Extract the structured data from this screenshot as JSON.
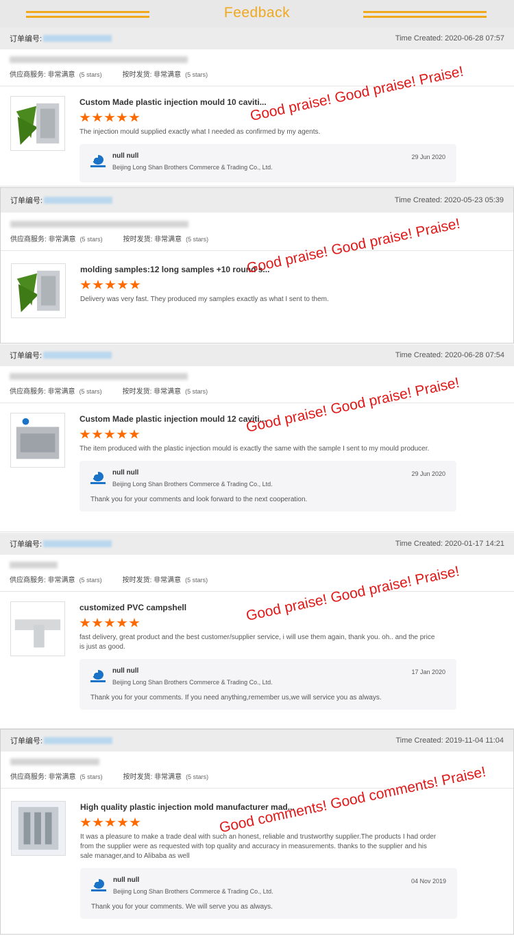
{
  "banner": {
    "title": "Feedback"
  },
  "labels": {
    "order": "订单编号:",
    "supplier_service": "供应商服务:",
    "ship_ontime": "按时发货:",
    "rating_value": "非常满意",
    "rating_stars": "(5 stars)",
    "reply_name": "null null",
    "reply_company": "Beijing Long Shan Brothers Commerce & Trading Co., Ltd."
  },
  "cards": [
    {
      "created": "Time Created: 2020-06-28 07:57",
      "title": "Custom Made plastic injection mould 10 caviti...",
      "comment": "The injection mould supplied exactly what I needed as confirmed by my agents.",
      "praise": "Good praise! Good praise! Praise!",
      "reply_date": "29 Jun 2020",
      "reply_text": ""
    },
    {
      "created": "Time Created: 2020-05-23 05:39",
      "title": "molding samples:12 long samples +10 round s...",
      "comment": "Delivery was very fast. They produced my samples exactly as what I sent to them.",
      "praise": "Good praise! Good praise! Praise!"
    },
    {
      "created": "Time Created: 2020-06-28 07:54",
      "title": "Custom Made plastic injection mould 12 caviti...",
      "comment": "The item produced with the plastic injection mould is exactly the same with the sample I sent to my mould producer.",
      "praise": "Good praise! Good praise! Praise!",
      "reply_date": "29 Jun 2020",
      "reply_text": "Thank you for your comments and look forward to the next cooperation."
    },
    {
      "created": "Time Created: 2020-01-17 14:21",
      "title": "customized PVC campshell",
      "comment": "fast delivery, great product and the best customer/supplier service, i will use them again, thank you. oh.. and the price is just as good.",
      "praise": "Good praise! Good praise! Praise!",
      "reply_date": "17 Jan 2020",
      "reply_text": "Thank you for your comments. If you need anything,remember us,we will service you as always."
    },
    {
      "created": "Time Created: 2019-11-04 11:04",
      "title": "High quality plastic injection mold manufacturer mad...",
      "comment": "It was a pleasure to make a trade deal with such an honest, reliable and trustworthy supplier.The products I had order from the supplier were as requested with top quality and accuracy in measurements. thanks to the supplier and his sale manager,and to Alibaba as well",
      "praise": "Good comments! Good comments! Praise!",
      "reply_date": "04 Nov 2019",
      "reply_text": "Thank you for your comments. We will serve you as always."
    }
  ],
  "colors": {
    "accent": "#f0a81e",
    "star": "#ff6a00",
    "praise": "#e01818",
    "header_bg": "#ececec"
  }
}
